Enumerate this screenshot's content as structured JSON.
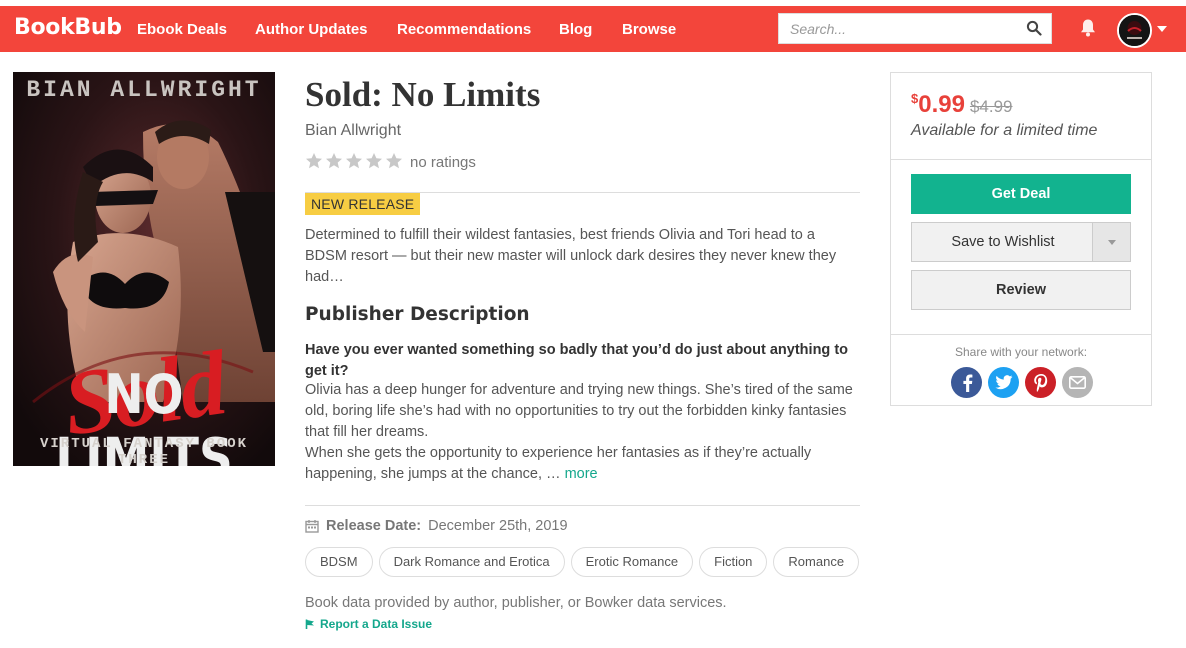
{
  "nav": {
    "brand": "BookBub",
    "links": [
      "Ebook Deals",
      "Author Updates",
      "Recommendations",
      "Blog",
      "Browse"
    ],
    "search_placeholder": "Search...",
    "brand_color": "#f3453b"
  },
  "cover": {
    "author": "BIAN ALLWRIGHT",
    "title_script": "Sold",
    "title_block": "NO LIMITS",
    "series": "VIRTUAL FANTASY BOOK THREE"
  },
  "book": {
    "title": "Sold: No Limits",
    "author": "Bian Allwright",
    "rating_stars": 0,
    "rating_text": "no ratings",
    "badge": "NEW RELEASE",
    "blurb": "Determined to fulfill their wildest fantasies, best friends Olivia and Tori head to a BDSM resort — but their new master will unlock dark desires they never knew they had…",
    "publisher_heading": "Publisher Description",
    "description_lead": "Have you ever wanted something so badly that you’d do just about anything to get it?",
    "description_p1": "Olivia has a deep hunger for adventure and trying new things. She’s tired of the same old, boring life she’s had with no opportunities to try out the forbidden kinky fantasies that fill her dreams.",
    "description_p2": "When she gets the opportunity to experience her fantasies as if they’re actually happening, she jumps at the chance, …",
    "more_label": "more",
    "release_label": "Release Date:",
    "release_date": "December 25th, 2019",
    "tags": [
      "BDSM",
      "Dark Romance and Erotica",
      "Erotic Romance",
      "Fiction",
      "Romance"
    ],
    "data_note": "Book data provided by author, publisher, or Bowker data services.",
    "report_label": "Report a Data Issue"
  },
  "deal": {
    "currency": "$",
    "price": "0.99",
    "old_price": "$4.99",
    "availability": "Available for a limited time",
    "get_deal_label": "Get Deal",
    "wishlist_label": "Save to Wishlist",
    "review_label": "Review",
    "share_label": "Share with your network:",
    "share_icons": [
      "facebook-icon",
      "twitter-icon",
      "pinterest-icon",
      "email-icon"
    ],
    "accent": "#12b38f",
    "price_color": "#e8413a"
  }
}
